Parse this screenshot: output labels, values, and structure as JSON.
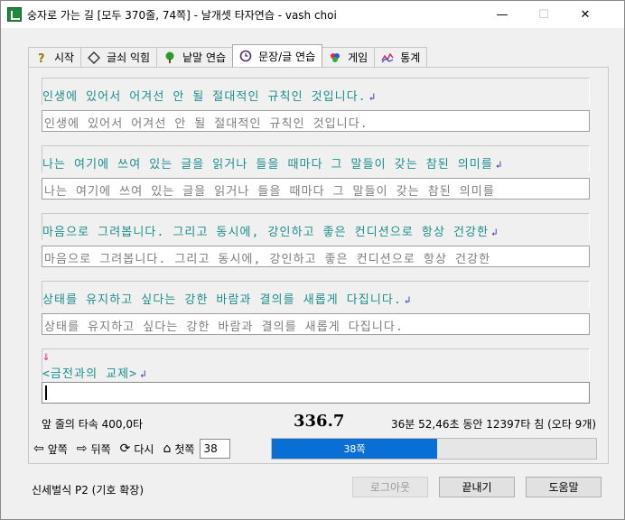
{
  "window": {
    "title": "숭자로 가는 길 [모두 370줄, 74쪽] - 날개셋 타자연습 - vash choi",
    "minimize": "—",
    "maximize": "☐",
    "close": "✕"
  },
  "tabs": [
    {
      "label": "시작",
      "icon": "question-icon"
    },
    {
      "label": "글쇠 익힘",
      "icon": "diamond-icon"
    },
    {
      "label": "낱말 연습",
      "icon": "tree-icon"
    },
    {
      "label": "문장/글 연습",
      "icon": "clock-icon",
      "active": true
    },
    {
      "label": "게임",
      "icon": "game-icon"
    },
    {
      "label": "통계",
      "icon": "chart-icon"
    }
  ],
  "practice": {
    "lines": [
      {
        "source": "인생에 있어서 어겨선 안 될 절대적인 규칙인 것입니다.",
        "typed": "인생에 있어서 어겨선 안 될 절대적인 규칙인 것입니다."
      },
      {
        "source": "나는 여기에 쓰여 있는 글을 읽거나 들을 때마다 그 말들이 갖는 참된 의미를",
        "typed": "나는 여기에 쓰여 있는 글을 읽거나 들을 때마다 그 말들이 갖는 참된 의미를"
      },
      {
        "source": "마음으로 그려봅니다. 그리고 동시에, 강인하고 좋은 컨디션으로 항상 건강한",
        "typed": "마음으로 그려봅니다. 그리고 동시에, 강인하고 좋은 컨디션으로 항상 건강한"
      },
      {
        "source": "상태를 유지하고 싶다는 강한 바람과 결의를 새롭게 다집니다.",
        "typed": "상태를 유지하고 싶다는 강한 바람과 결의를 새롭게 다집니다."
      }
    ],
    "enter_mark": "↲",
    "next_marker": "⇓",
    "next_line": "<금전과의 교제>",
    "current_input": ""
  },
  "stats": {
    "prev_line_speed": "앞 줄의 타속 400,0타",
    "current_speed": "336.7",
    "summary": "36분 52,46초 동안 12397타 침 (오타 9개)"
  },
  "nav": {
    "prev": "앞쪽",
    "next": "뒤쪽",
    "again": "다시",
    "first": "첫쪽",
    "page_value": "38",
    "progress_label": "38쪽",
    "progress_fraction": 0.51
  },
  "footer": {
    "layout_name": "신세벌식 P2 (기호 확장)",
    "logout": "로그아웃",
    "finish": "끝내기",
    "help": "도움말"
  }
}
